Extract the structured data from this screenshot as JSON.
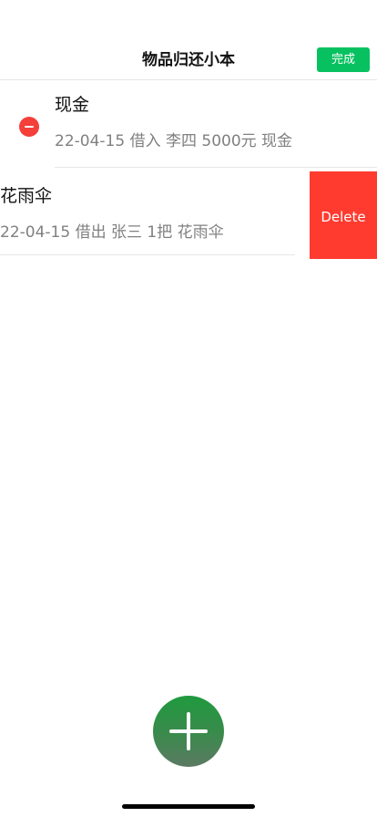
{
  "navbar": {
    "title": "物品归还小本",
    "done_label": "完成"
  },
  "colors": {
    "accent": "#07c160",
    "delete": "#ff3b30",
    "delete_control": "#f43f3a"
  },
  "items": [
    {
      "title": "现金",
      "detail": "22-04-15 借入 李四 5000元 现金"
    },
    {
      "title": "花雨伞",
      "detail": "22-04-15 借出 张三 1把 花雨伞"
    }
  ],
  "swipe_action": {
    "label": "Delete"
  },
  "icons": {
    "row_delete": "minus-circle-icon",
    "add": "plus-icon"
  }
}
